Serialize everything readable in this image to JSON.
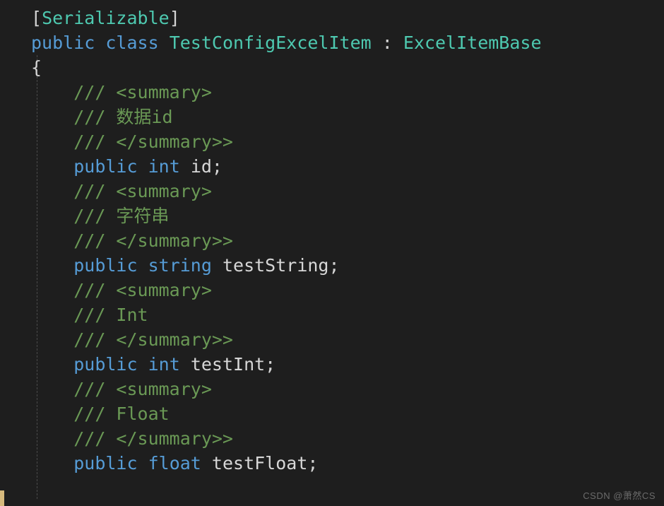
{
  "colors": {
    "background": "#1e1e1e",
    "punctuation": "#d4d4d4",
    "type": "#4ec9b0",
    "keyword": "#569cd6",
    "identifier": "#d7d7d7",
    "comment": "#6a9955",
    "modified_bar": "#d7ba7d",
    "indent_guide": "#4a4a4a",
    "watermark": "#6b6b6b"
  },
  "watermark": "CSDN @萧然CS",
  "code_lines": [
    [
      {
        "t": "[",
        "c": "tok-punc"
      },
      {
        "t": "Serializable",
        "c": "tok-attr"
      },
      {
        "t": "]",
        "c": "tok-punc"
      }
    ],
    [
      {
        "t": "public",
        "c": "tok-kw"
      },
      {
        "t": " ",
        "c": "tok-punc"
      },
      {
        "t": "class",
        "c": "tok-kw"
      },
      {
        "t": " ",
        "c": "tok-punc"
      },
      {
        "t": "TestConfigExcelItem",
        "c": "tok-type"
      },
      {
        "t": " : ",
        "c": "tok-punc"
      },
      {
        "t": "ExcelItemBase",
        "c": "tok-type"
      }
    ],
    [
      {
        "t": "{",
        "c": "tok-punc"
      }
    ],
    [
      {
        "t": "    ",
        "c": "tok-punc"
      },
      {
        "t": "/// <summary>",
        "c": "tok-comm"
      }
    ],
    [
      {
        "t": "    ",
        "c": "tok-punc"
      },
      {
        "t": "/// 数据id",
        "c": "tok-comm"
      }
    ],
    [
      {
        "t": "    ",
        "c": "tok-punc"
      },
      {
        "t": "/// </summary>>",
        "c": "tok-comm"
      }
    ],
    [
      {
        "t": "    ",
        "c": "tok-punc"
      },
      {
        "t": "public",
        "c": "tok-kw"
      },
      {
        "t": " ",
        "c": "tok-punc"
      },
      {
        "t": "int",
        "c": "tok-basety"
      },
      {
        "t": " ",
        "c": "tok-punc"
      },
      {
        "t": "id",
        "c": "tok-ident"
      },
      {
        "t": ";",
        "c": "tok-punc"
      }
    ],
    [
      {
        "t": "    ",
        "c": "tok-punc"
      },
      {
        "t": "/// <summary>",
        "c": "tok-comm"
      }
    ],
    [
      {
        "t": "    ",
        "c": "tok-punc"
      },
      {
        "t": "/// 字符串",
        "c": "tok-comm"
      }
    ],
    [
      {
        "t": "    ",
        "c": "tok-punc"
      },
      {
        "t": "/// </summary>>",
        "c": "tok-comm"
      }
    ],
    [
      {
        "t": "    ",
        "c": "tok-punc"
      },
      {
        "t": "public",
        "c": "tok-kw"
      },
      {
        "t": " ",
        "c": "tok-punc"
      },
      {
        "t": "string",
        "c": "tok-basety"
      },
      {
        "t": " ",
        "c": "tok-punc"
      },
      {
        "t": "testString",
        "c": "tok-ident"
      },
      {
        "t": ";",
        "c": "tok-punc"
      }
    ],
    [
      {
        "t": "    ",
        "c": "tok-punc"
      },
      {
        "t": "/// <summary>",
        "c": "tok-comm"
      }
    ],
    [
      {
        "t": "    ",
        "c": "tok-punc"
      },
      {
        "t": "/// Int",
        "c": "tok-comm"
      }
    ],
    [
      {
        "t": "    ",
        "c": "tok-punc"
      },
      {
        "t": "/// </summary>>",
        "c": "tok-comm"
      }
    ],
    [
      {
        "t": "    ",
        "c": "tok-punc"
      },
      {
        "t": "public",
        "c": "tok-kw"
      },
      {
        "t": " ",
        "c": "tok-punc"
      },
      {
        "t": "int",
        "c": "tok-basety"
      },
      {
        "t": " ",
        "c": "tok-punc"
      },
      {
        "t": "testInt",
        "c": "tok-ident"
      },
      {
        "t": ";",
        "c": "tok-punc"
      }
    ],
    [
      {
        "t": "    ",
        "c": "tok-punc"
      },
      {
        "t": "/// <summary>",
        "c": "tok-comm"
      }
    ],
    [
      {
        "t": "    ",
        "c": "tok-punc"
      },
      {
        "t": "/// Float",
        "c": "tok-comm"
      }
    ],
    [
      {
        "t": "    ",
        "c": "tok-punc"
      },
      {
        "t": "/// </summary>>",
        "c": "tok-comm"
      }
    ],
    [
      {
        "t": "    ",
        "c": "tok-punc"
      },
      {
        "t": "public",
        "c": "tok-kw"
      },
      {
        "t": " ",
        "c": "tok-punc"
      },
      {
        "t": "float",
        "c": "tok-basety"
      },
      {
        "t": " ",
        "c": "tok-punc"
      },
      {
        "t": "testFloat",
        "c": "tok-ident"
      },
      {
        "t": ";",
        "c": "tok-punc"
      }
    ]
  ]
}
